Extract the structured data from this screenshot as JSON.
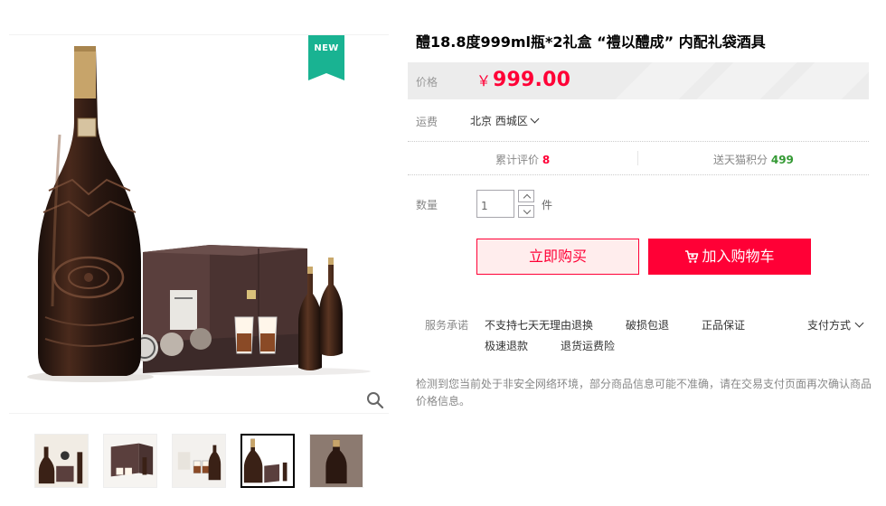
{
  "gallery": {
    "badge": "NEW",
    "main_image": "product-bottle-giftbox-image",
    "thumbnails": [
      {
        "name": "thumb-1",
        "active": false
      },
      {
        "name": "thumb-2",
        "active": false
      },
      {
        "name": "thumb-3",
        "active": false
      },
      {
        "name": "thumb-4",
        "active": true
      },
      {
        "name": "thumb-5",
        "active": false
      }
    ]
  },
  "product": {
    "title": "醴18.8度999ml瓶*2礼盒 “禮以醴成” 内配礼袋酒具",
    "price_label": "价格",
    "currency": "￥",
    "price": "999.00"
  },
  "shipping": {
    "label": "运费",
    "region": "北京 西城区"
  },
  "stats": {
    "reviews_label": "累计评价",
    "reviews_count": "8",
    "points_label": "送天猫积分",
    "points_value": "499"
  },
  "quantity": {
    "label": "数量",
    "value": "1",
    "unit": "件"
  },
  "actions": {
    "buy_now": "立即购买",
    "add_to_cart": "加入购物车"
  },
  "services": {
    "label": "服务承诺",
    "items": [
      "不支持七天无理由退换",
      "破损包退",
      "正品保证",
      "极速退款",
      "退货运费险"
    ],
    "payment_methods": "支付方式"
  },
  "notice": "检测到您当前处于非安全网络环境，部分商品信息可能不准确，请在交易支付页面再次确认商品价格信息。",
  "colors": {
    "accent": "#ff0036",
    "badge": "#19b392",
    "points": "#390"
  }
}
